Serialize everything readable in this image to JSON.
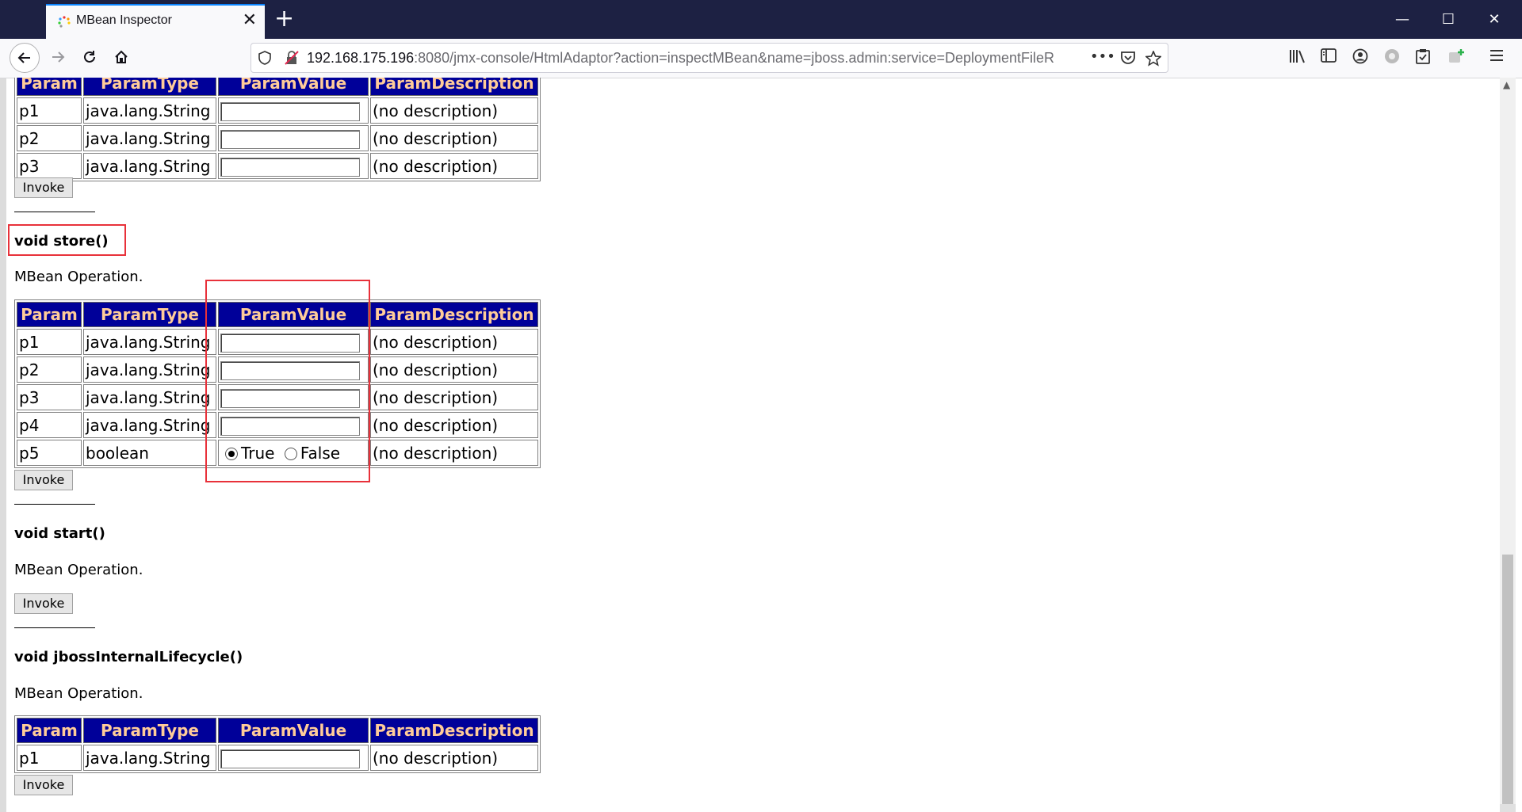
{
  "browser": {
    "tab_title": "MBean Inspector",
    "tab_close": "✕",
    "new_tab": "+",
    "url_host": "192.168.175.196",
    "url_rest": ":8080/jmx-console/HtmlAdaptor?action=inspectMBean&name=jboss.admin:service=DeploymentFileR",
    "url_more": "•••",
    "minimize": "—",
    "maximize": "☐",
    "close": "✕"
  },
  "table_headers": [
    "Param",
    "ParamType",
    "ParamValue",
    "ParamDescription"
  ],
  "top_table": {
    "rows": [
      {
        "param": "p1",
        "type": "java.lang.String",
        "desc": "(no description)"
      },
      {
        "param": "p2",
        "type": "java.lang.String",
        "desc": "(no description)"
      },
      {
        "param": "p3",
        "type": "java.lang.String",
        "desc": "(no description)"
      }
    ],
    "invoke": "Invoke"
  },
  "store_op": {
    "title": "void store()",
    "desc": "MBean Operation.",
    "rows": [
      {
        "param": "p1",
        "type": "java.lang.String",
        "desc": "(no description)"
      },
      {
        "param": "p2",
        "type": "java.lang.String",
        "desc": "(no description)"
      },
      {
        "param": "p3",
        "type": "java.lang.String",
        "desc": "(no description)"
      },
      {
        "param": "p4",
        "type": "java.lang.String",
        "desc": "(no description)"
      }
    ],
    "bool_row": {
      "param": "p5",
      "type": "boolean",
      "true_label": "True",
      "false_label": "False",
      "selected": "True",
      "desc": "(no description)"
    },
    "invoke": "Invoke"
  },
  "start_op": {
    "title": "void start()",
    "desc": "MBean Operation.",
    "invoke": "Invoke"
  },
  "lifecycle_op": {
    "title": "void jbossInternalLifecycle()",
    "desc": "MBean Operation.",
    "rows": [
      {
        "param": "p1",
        "type": "java.lang.String",
        "desc": "(no description)"
      }
    ],
    "invoke": "Invoke"
  },
  "colors": {
    "header_bg": "#000099",
    "header_text": "#ffcc99",
    "highlight": "#e8313a",
    "tabbar": "#1d2143"
  }
}
